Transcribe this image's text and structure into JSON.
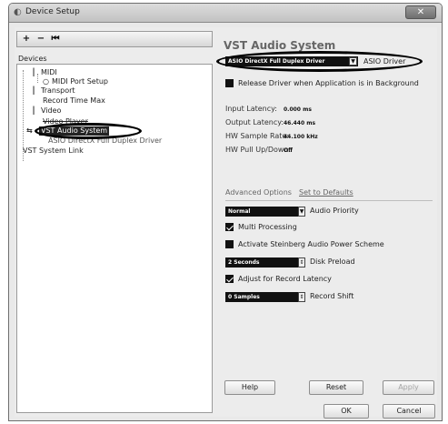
{
  "window": {
    "title": "Device Setup",
    "close_glyph": "✕"
  },
  "toolbar": {
    "add_glyph": "+",
    "remove_glyph": "−",
    "reset_glyph": "⏮"
  },
  "devices_label": "Devices",
  "tree": {
    "midi": "MIDI",
    "midi_port_setup": "MIDI Port Setup",
    "transport": "Transport",
    "record_time_max": "Record Time Max",
    "video": "Video",
    "video_player": "Video Player",
    "vst_audio_system": "VST Audio System",
    "asio_driver": "ASIO DirectX Full Duplex Driver",
    "vst_system_link": "VST System Link"
  },
  "panel": {
    "title": "VST Audio System",
    "driver_value": "ASIO DirectX Full Duplex Driver",
    "driver_label": "ASIO Driver",
    "release_driver": "Release Driver when Application is in Background",
    "input_latency_label": "Input Latency:",
    "input_latency_value": "0.000 ms",
    "output_latency_label": "Output Latency:",
    "output_latency_value": "46.440 ms",
    "hw_sample_rate_label": "HW Sample Rate:",
    "hw_sample_rate_value": "44.100 kHz",
    "hw_pull_label": "HW Pull Up/Down:",
    "hw_pull_value": "Off",
    "advanced_options": "Advanced Options",
    "set_to_defaults": "Set to Defaults",
    "audio_priority_value": "Normal",
    "audio_priority_label": "Audio Priority",
    "multi_processing": "Multi Processing",
    "steinberg_power": "Activate Steinberg Audio Power Scheme",
    "disk_preload_value": "2 Seconds",
    "disk_preload_label": "Disk Preload",
    "adjust_latency": "Adjust for Record Latency",
    "record_shift_value": "0 Samples",
    "record_shift_label": "Record Shift"
  },
  "buttons": {
    "help": "Help",
    "reset": "Reset",
    "apply": "Apply",
    "ok": "OK",
    "cancel": "Cancel"
  },
  "colors": {
    "selected_bg": "#222222",
    "window_bg": "#e9e9e9"
  }
}
